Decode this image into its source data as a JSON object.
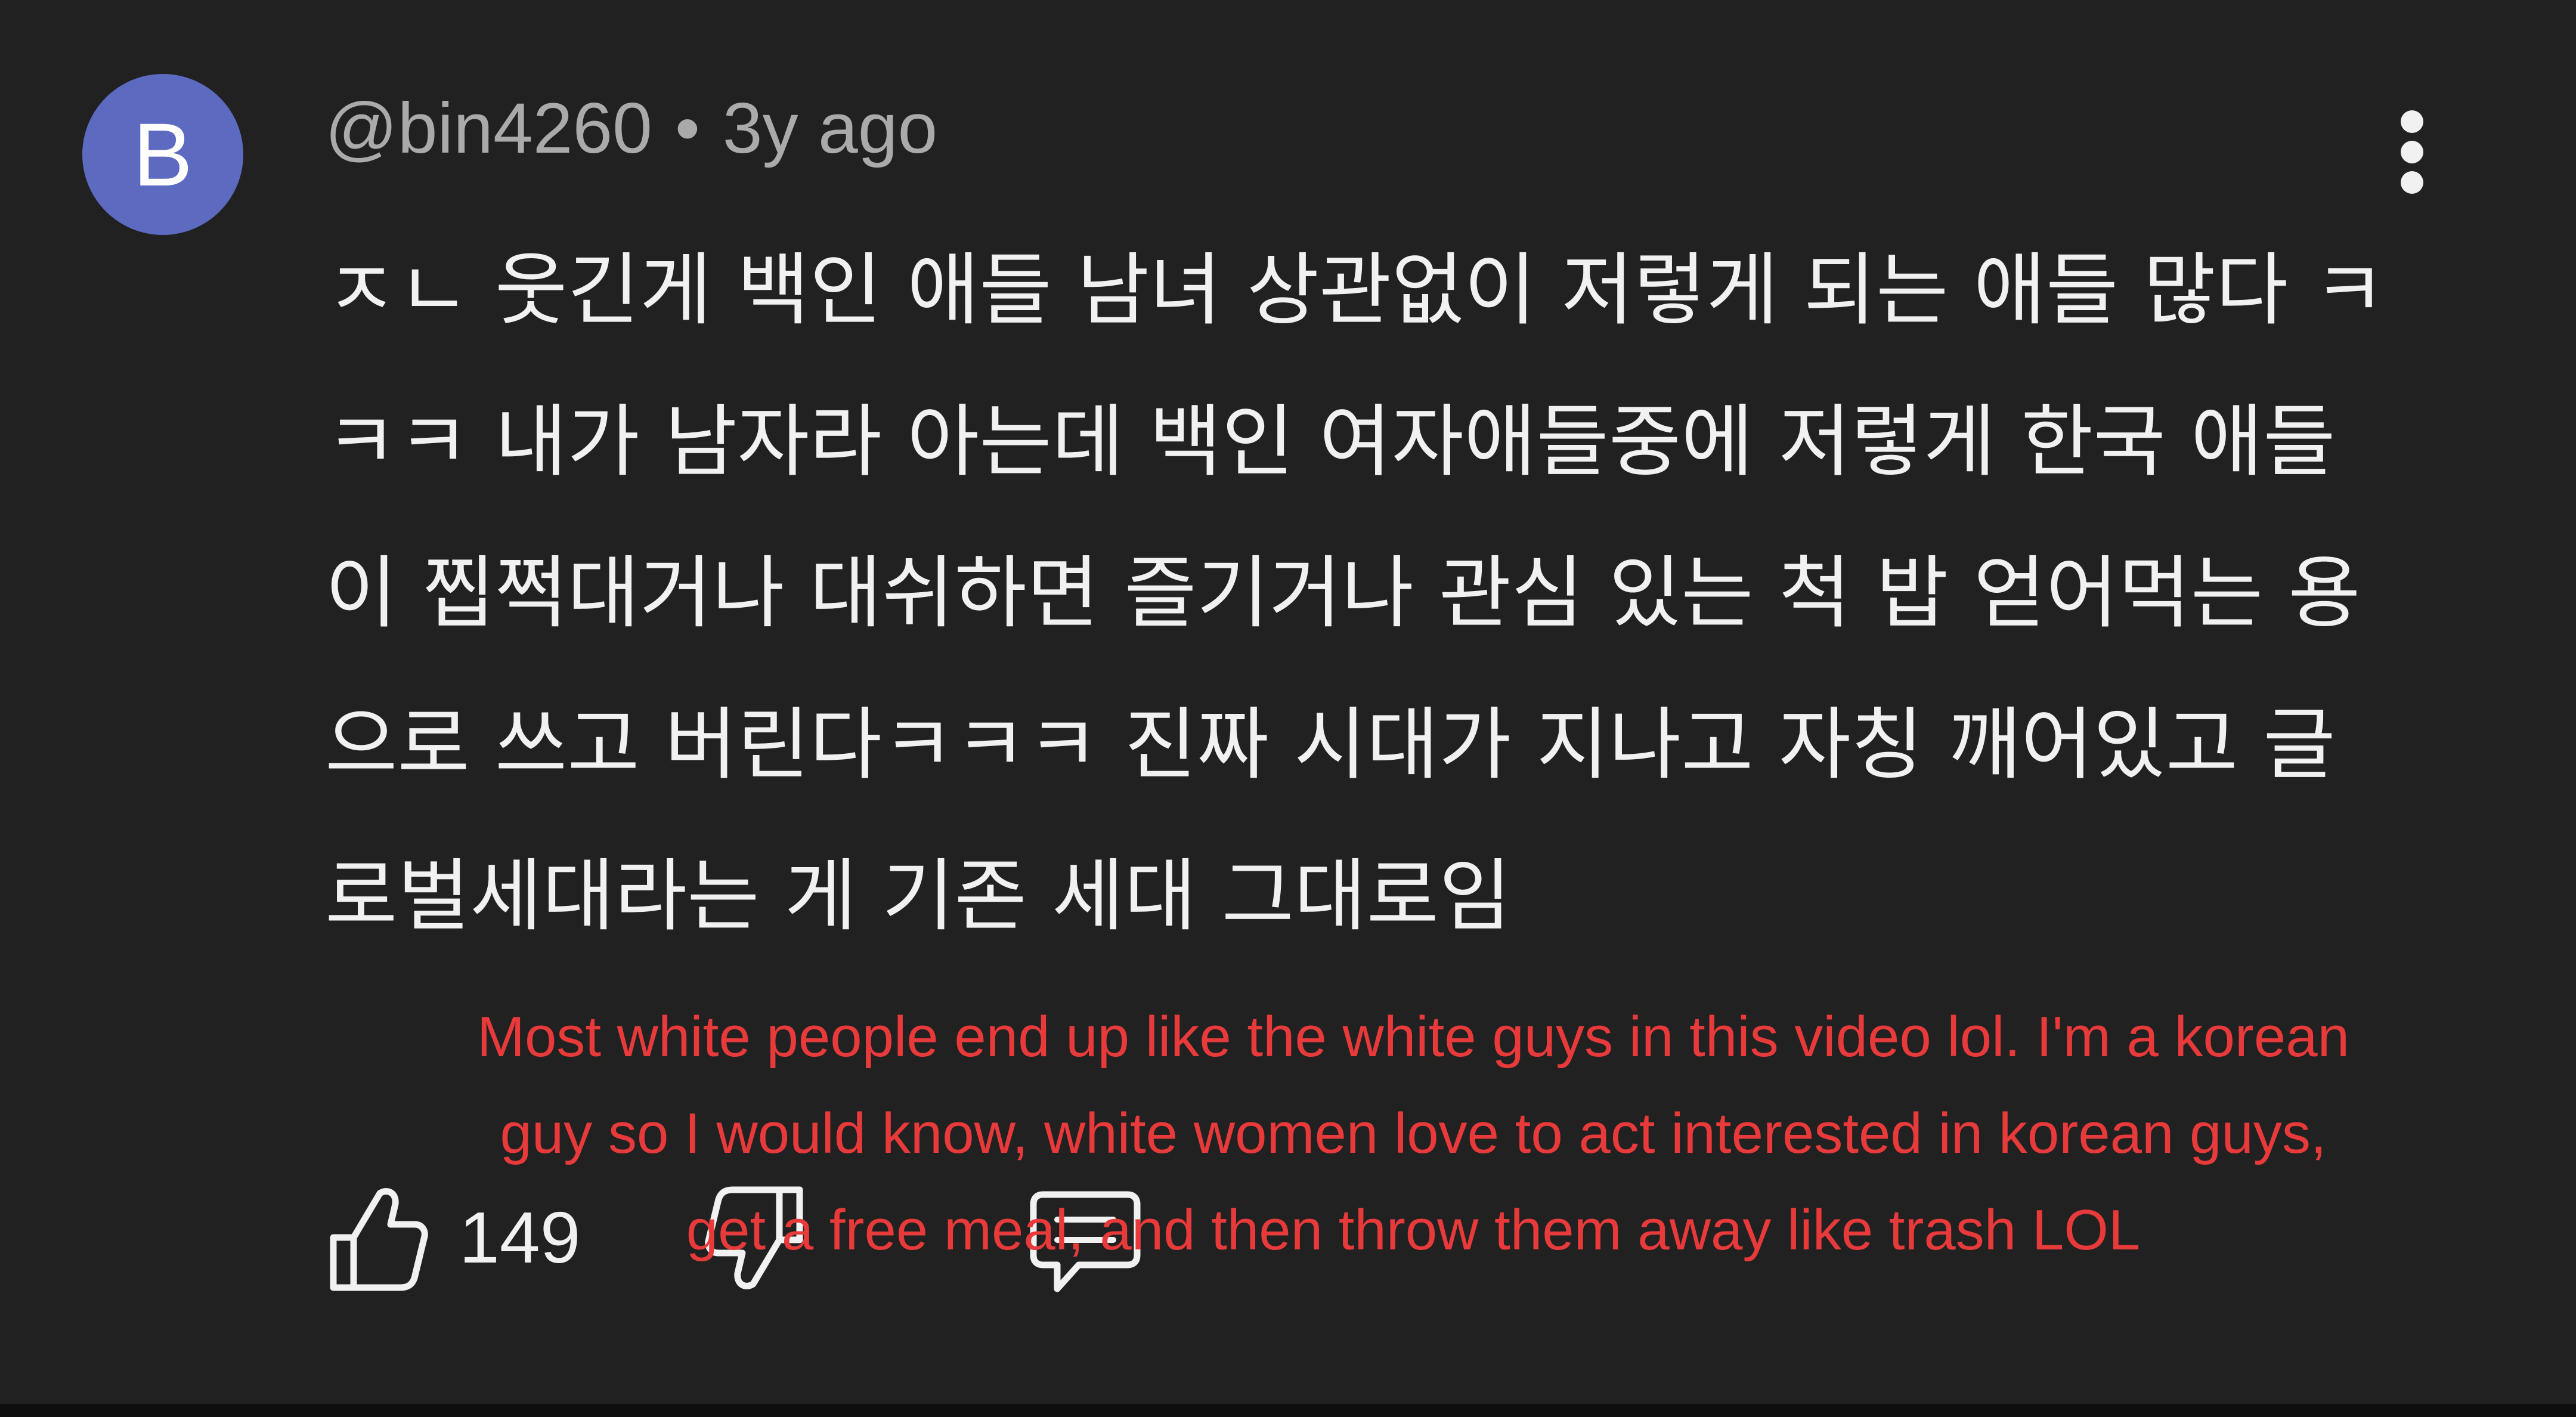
{
  "comment": {
    "avatar_letter": "B",
    "author": "@bin4260",
    "separator": "•",
    "timestamp": "3y ago",
    "text": "ㅈㄴ 웃긴게 백인 애들 남녀 상관없이 저렇게 되는 애들 많다 ㅋㅋㅋ 내가 남자라 아는데 백인 여자애들중에 저렇게 한국 애들이 찝쩍대거나 대쉬하면 즐기거나 관심 있는 척 밥 얻어먹는 용으로 쓰고 버린다ㅋㅋㅋ 진짜 시대가 지나고 자칭 깨어있고 글로벌세대라는 게 기존 세대 그대로임",
    "like_count": "149"
  },
  "translation_overlay": {
    "text": "Most white people end up like the white guys in this video lol. I'm a korean guy so I would know, white women love to act interested in korean guys, get a free meal, and then throw them away like trash LOL",
    "color": "#e83a3a"
  },
  "icons": {
    "more": "more-vertical-icon",
    "like": "thumbs-up-icon",
    "dislike": "thumbs-down-icon",
    "reply": "comment-icon"
  },
  "colors": {
    "background": "#212121",
    "avatar": "#5c6bc0",
    "text_primary": "#f1f1f1",
    "text_secondary": "#aaaaaa"
  }
}
